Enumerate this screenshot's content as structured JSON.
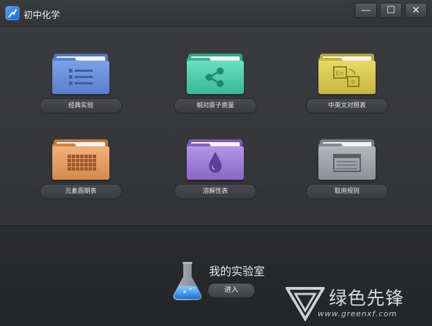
{
  "window": {
    "title": "初中化学",
    "controls": {
      "minimize": "—",
      "maximize": "☐",
      "close": "✕"
    }
  },
  "tiles": [
    {
      "label": "经典实验",
      "icon": "list-icon",
      "color": "#6b8fd8"
    },
    {
      "label": "相对原子质量",
      "icon": "share-nodes-icon",
      "color": "#48c7a6"
    },
    {
      "label": "中英文对照表",
      "icon": "translate-icon",
      "color": "#d6c64d"
    },
    {
      "label": "元素周期表",
      "icon": "periodic-table-icon",
      "color": "#e39a5c"
    },
    {
      "label": "溶解性表",
      "icon": "droplet-icon",
      "color": "#9b7ad0"
    },
    {
      "label": "取用规则",
      "icon": "window-icon",
      "color": "#9a9ca2"
    }
  ],
  "lab": {
    "title": "我的实验室",
    "enter_label": "进入",
    "icon": "flask-icon"
  },
  "watermark": {
    "name": "绿色先锋",
    "url": "www.greenxf.com"
  }
}
